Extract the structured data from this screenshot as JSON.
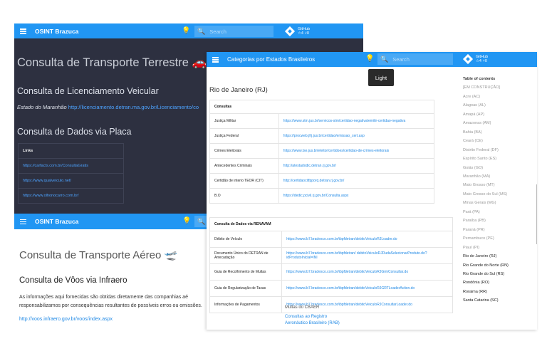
{
  "w1": {
    "brand": "OSINT Brazuca",
    "search_placeholder": "Search",
    "github": {
      "label": "GitHub",
      "stats": "☆4 ⑂0"
    },
    "title": "Consulta de Transporte Terrestre 🚗",
    "section1": "Consulta de Licenciamento Veicular",
    "para_state": "Estado do Maranhão",
    "para_link": "http://licenciamento.detran.ma.gov.br/Licenciamento/co",
    "section2": "Consulta de Dados via Placa",
    "table_header": "Links",
    "links": [
      "https://carfacts.com.br/ConsultaGratis",
      "https://www.qualveiculo.net/",
      "https://www.olhonocarro.com.br/"
    ]
  },
  "w2": {
    "brand": "OSINT Brazuca",
    "title": "Consulta de Transporte Aéreo 🛫",
    "section": "Consulta de Vôos via Infraero",
    "para": "As informações aqui fornecidas são obtidas diretamente das companhias aé responsabilizamos por consequências resultantes de possíveis erros ou omissões.",
    "link": "http://voos.infraero.gov.br/voos/index.aspx"
  },
  "w3": {
    "title": "Categorias por Estados Brasileiros",
    "search_placeholder": "Search",
    "tooltip": "Light",
    "github": {
      "label": "GitHub",
      "stats": "☆4 ⑂0"
    },
    "state": "Rio de Janeiro (RJ)",
    "consultas_header": "Consultas",
    "consultas": [
      {
        "name": "Justiça Militar",
        "url": "https://www.stm.jus.br/servicos-stm/certidao-negativa/emitir-certidao-negativa"
      },
      {
        "name": "Justiça Federal",
        "url": "https://procweb.jfrj.jus.br/certidao/emissao_cert.asp"
      },
      {
        "name": "Crimes Eleitorais",
        "url": "https://www.tse.jus.br/eleitor/certidoes/certidao-de-crimes-eleitorais"
      },
      {
        "name": "Antecedentes Criminais",
        "url": "http://atestadodic.detran.rj.gov.br/"
      },
      {
        "name": "Certidão de interio TEOR (CIT)",
        "url": "http://certidaocitfpporq.detran.rj.gov.br/"
      },
      {
        "name": "B.O",
        "url": "https://dedic.pcivil.rj.gov.br/Consulta.aspx"
      }
    ],
    "renavam_header": "Consulta de Dados via RENAVAM",
    "renavam": [
      {
        "name": "Débito de Veículo",
        "url": "https://www.ib7.bradesco.com.br/ibpfdetran/debitoVeiculoRJLoader.do"
      },
      {
        "name": "Documento Único do DETRAN de Arrecadação",
        "url": "https://www.ib7.bradesco.com.br/ibpfdetran/ debitoVeiculoRJDudaSelecionarProduto.do?idProdutoInicial=INI"
      },
      {
        "name": "Guia de Recolhimento de Multas",
        "url": "https://www.ib7.bradesco.com.br/ibpfdetran/debitoVeiculoRJGrmConsultar.do"
      },
      {
        "name": "Guia de Regularização de Taxas",
        "url": "https://www.ib7.bradesco.com.br/ibpfdetran/debitoVeiculoRJGRTLoaderAction.do"
      },
      {
        "name": "Informações de Pagamentos",
        "url": "https://www.ib7.bradesco.com.br/ibpfdetran/debitoVeiculoRJConsultarLoader.do"
      }
    ],
    "after_text": "Multas do CBAER",
    "after_links": [
      "Consultas ao Registro",
      "Aeronáutico Brasileiro (RAB)"
    ],
    "toc_title": "Table of contents",
    "toc": [
      "[EM CONSTRUÇÃO]",
      "Acre (AC)",
      "Alagoas (AL)",
      "Amapá (AP)",
      "Amazonas (AM)",
      "Bahia (BA)",
      "Ceará (CE)",
      "Distrito Federal (DF)",
      "Espírito Santo (ES)",
      "Goiás (GO)",
      "Maranhão (MA)",
      "Mato Grosso (MT)",
      "Mato Grosso do Sul (MS)",
      "Minas Gerais (MG)",
      "Pará (PA)",
      "Paraíba (PB)",
      "Paraná (PR)",
      "Pernambuco (PE)",
      "Piauí (PI)",
      "Rio de Janeiro (RJ)",
      "Rio Grande do Norte (RN)",
      "Rio Grande do Sul (RS)",
      "Rondônia (RO)",
      "Roraima (RR)",
      "Santa Catarina (SC)"
    ],
    "toc_dark_from": 19
  }
}
